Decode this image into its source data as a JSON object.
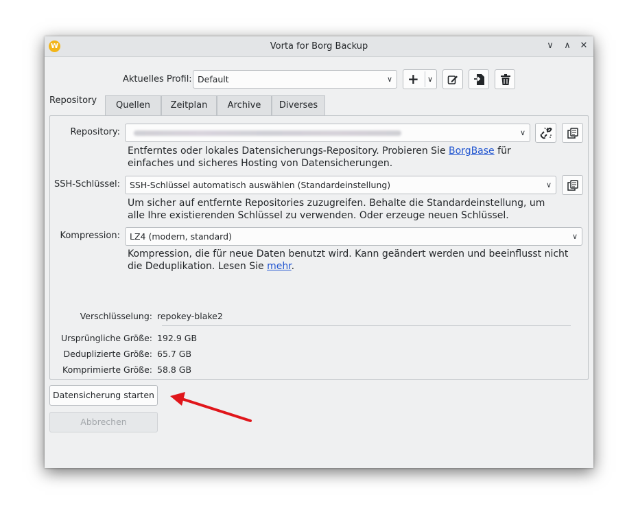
{
  "window": {
    "title": "Vorta for Borg Backup",
    "app_icon_letter": "W"
  },
  "titlebar": {
    "minimize_glyph": "∨",
    "maximize_glyph": "∧",
    "close_glyph": "✕"
  },
  "profile": {
    "label": "Aktuelles Profil:",
    "value": "Default",
    "add_glyph": "+",
    "dropdown_glyph": "∨"
  },
  "tabs": [
    {
      "label": "Repository"
    },
    {
      "label": "Quellen"
    },
    {
      "label": "Zeitplan"
    },
    {
      "label": "Archive"
    },
    {
      "label": "Diverses"
    }
  ],
  "repository": {
    "label": "Repository:",
    "desc_text_1": "Entferntes oder lokales Datensicherungs-Repository. Probieren Sie ",
    "desc_link": "BorgBase",
    "desc_text_2": " für",
    "desc_line_2": "einfaches und sicheres Hosting von Datensicherungen."
  },
  "ssh": {
    "label": "SSH-Schlüssel:",
    "value": "SSH-Schlüssel automatisch auswählen (Standardeinstellung)",
    "desc_line_1": "Um sicher auf entfernte Repositories zuzugreifen. Behalte die Standardeinstellung, um",
    "desc_line_2": "alle Ihre existierenden Schlüssel zu verwenden. Oder erzeuge neuen Schlüssel."
  },
  "compression": {
    "label": "Kompression:",
    "value": "LZ4 (modern, standard)",
    "desc_line_1": "Kompression, die für neue Daten benutzt wird. Kann geändert werden und beeinflusst nicht",
    "desc_text_2": "die Deduplikation. Lesen Sie ",
    "desc_link": "mehr",
    "desc_text_3": "."
  },
  "stats": {
    "encryption_label": "Verschlüsselung:",
    "encryption_value": "repokey-blake2",
    "original_label": "Ursprüngliche Größe:",
    "original_value": "192.9 GB",
    "dedup_label": "Deduplizierte Größe:",
    "dedup_value": "65.7 GB",
    "compressed_label": "Komprimierte Größe:",
    "compressed_value": "58.8 GB"
  },
  "actions": {
    "start_label": "Datensicherung starten",
    "cancel_label": "Abbrechen"
  },
  "colors": {
    "window_bg": "#eff0f1",
    "link": "#2155d0",
    "annotation_arrow": "#e0161b",
    "app_icon": "#f2b519"
  }
}
